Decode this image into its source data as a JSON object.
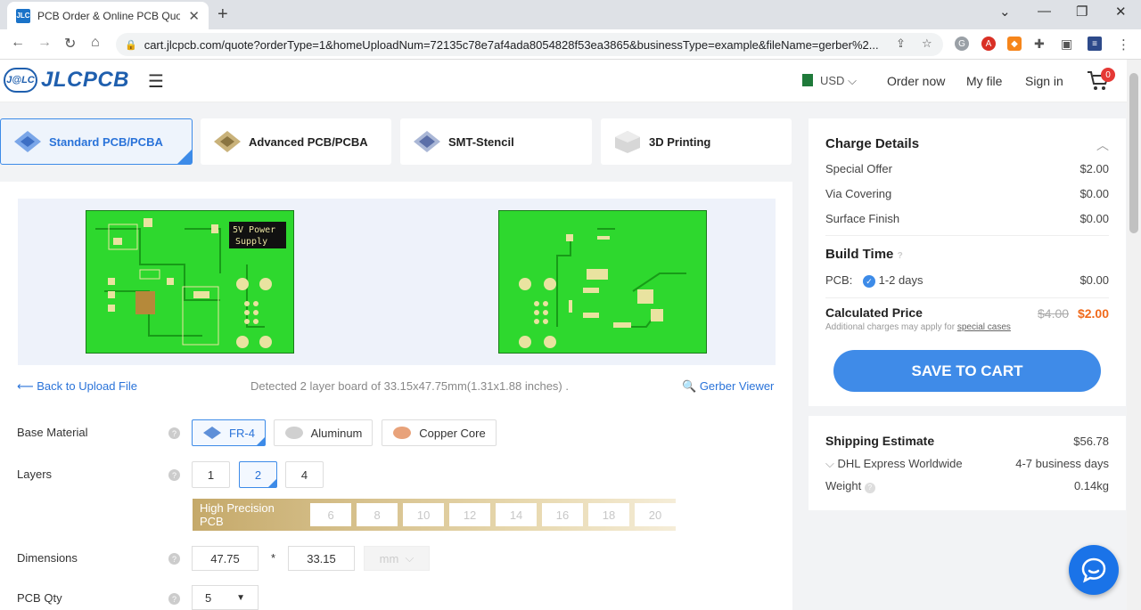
{
  "browser": {
    "tab_title": "PCB Order & Online PCB Quote &",
    "tab_favicon": "JLC",
    "url": "cart.jlcpcb.com/quote?orderType=1&homeUploadNum=72135c78e7af4ada8054828f53ea3865&businessType=example&fileName=gerber%2..."
  },
  "header": {
    "logo_badge": "J@LC",
    "logo_text": "JLCPCB",
    "currency": "USD",
    "links": [
      "Order now",
      "My file",
      "Sign in"
    ],
    "cart_count": "0"
  },
  "product_tabs": [
    {
      "label": "Standard PCB/PCBA",
      "active": true
    },
    {
      "label": "Advanced PCB/PCBA",
      "active": false
    },
    {
      "label": "SMT-Stencil",
      "active": false
    },
    {
      "label": "3D Printing",
      "active": false
    }
  ],
  "preview": {
    "board_text": [
      "5V Power",
      "Supply"
    ],
    "back_link": "Back to Upload File",
    "detected": "Detected 2 layer board of 33.15x47.75mm(1.31x1.88 inches) .",
    "gerber_link": "Gerber Viewer"
  },
  "options": {
    "base_material": {
      "label": "Base Material",
      "choices": [
        "FR-4",
        "Aluminum",
        "Copper Core"
      ],
      "selected": "FR-4"
    },
    "layers": {
      "label": "Layers",
      "choices": [
        "1",
        "2",
        "4"
      ],
      "selected": "2"
    },
    "high_precision": {
      "label": "High Precision PCB",
      "choices": [
        "6",
        "8",
        "10",
        "12",
        "14",
        "16",
        "18",
        "20"
      ]
    },
    "dimensions": {
      "label": "Dimensions",
      "width": "47.75",
      "sep": "*",
      "height": "33.15",
      "unit": "mm"
    },
    "qty": {
      "label": "PCB Qty",
      "value": "5"
    }
  },
  "charge": {
    "title": "Charge Details",
    "items": [
      {
        "k": "Special Offer",
        "v": "$2.00"
      },
      {
        "k": "Via Covering",
        "v": "$0.00"
      },
      {
        "k": "Surface Finish",
        "v": "$0.00"
      }
    ],
    "build_time_title": "Build Time",
    "build_pcb_label": "PCB:",
    "build_option": "1-2 days",
    "build_cost": "$0.00",
    "calc_title": "Calculated Price",
    "calc_old": "$4.00",
    "calc_new": "$2.00",
    "calc_note": "Additional charges may apply for",
    "calc_note_link": "special cases",
    "save_btn": "SAVE TO CART"
  },
  "shipping": {
    "title": "Shipping Estimate",
    "price": "$56.78",
    "method": "DHL Express Worldwide",
    "days": "4-7 business days",
    "weight_label": "Weight",
    "weight": "0.14kg"
  },
  "colors": {
    "accent": "#3d8be8",
    "price_red": "#f06a1b",
    "pcb_green": "#2ed82e"
  }
}
